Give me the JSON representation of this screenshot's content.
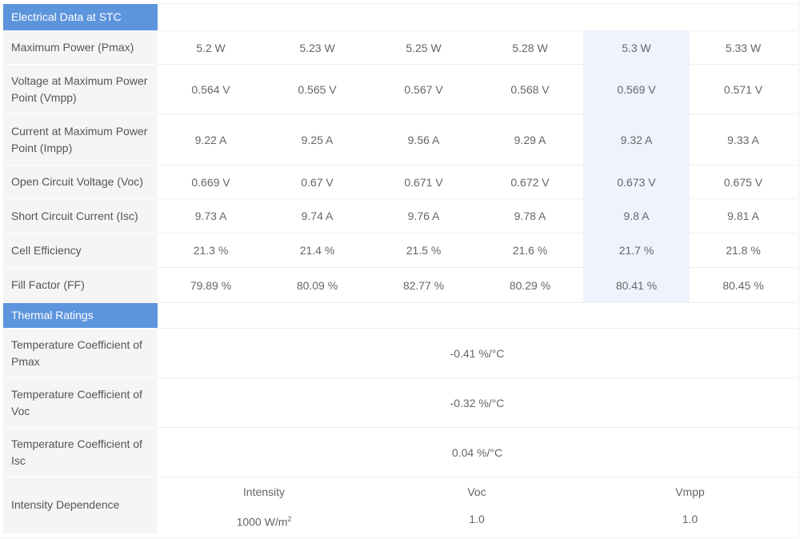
{
  "electrical": {
    "section_title": "Electrical Data at STC",
    "rows": [
      {
        "label": "Maximum Power (Pmax)",
        "values": [
          "5.2 W",
          "5.23 W",
          "5.25 W",
          "5.28 W",
          "5.3 W",
          "5.33 W"
        ]
      },
      {
        "label": "Voltage at Maximum Power Point (Vmpp)",
        "values": [
          "0.564 V",
          "0.565 V",
          "0.567 V",
          "0.568 V",
          "0.569 V",
          "0.571 V"
        ]
      },
      {
        "label": "Current at Maximum Power Point (Impp)",
        "values": [
          "9.22 A",
          "9.25 A",
          "9.56 A",
          "9.29 A",
          "9.32 A",
          "9.33 A"
        ]
      },
      {
        "label": "Open Circuit Voltage (Voc)",
        "values": [
          "0.669 V",
          "0.67 V",
          "0.671 V",
          "0.672 V",
          "0.673 V",
          "0.675 V"
        ]
      },
      {
        "label": "Short Circuit Current (Isc)",
        "values": [
          "9.73 A",
          "9.74 A",
          "9.76 A",
          "9.78 A",
          "9.8 A",
          "9.81 A"
        ]
      },
      {
        "label": "Cell Efficiency",
        "values": [
          "21.3 %",
          "21.4 %",
          "21.5 %",
          "21.6 %",
          "21.7 %",
          "21.8 %"
        ]
      },
      {
        "label": "Fill Factor (FF)",
        "values": [
          "79.89 %",
          "80.09 %",
          "82.77 %",
          "80.29 %",
          "80.41 %",
          "80.45 %"
        ]
      }
    ]
  },
  "thermal": {
    "section_title": "Thermal Ratings",
    "rows": [
      {
        "label": "Temperature Coefficient of Pmax",
        "value": "-0.41 %/°C"
      },
      {
        "label": "Temperature Coefficient of Voc",
        "value": "-0.32 %/°C"
      },
      {
        "label": "Temperature Coefficient of Isc",
        "value": "0.04 %/°C"
      }
    ],
    "intensity": {
      "label": "Intensity Dependence",
      "headers": [
        "Intensity",
        "Voc",
        "Vmpp"
      ],
      "values": [
        "1000 W/m",
        "1.0",
        "1.0"
      ],
      "intensity_unit_exponent": "2"
    }
  },
  "colors": {
    "section_header": "#5d95dc",
    "label_bg": "#f5f5f5",
    "highlight_column": "#eef3fd"
  }
}
